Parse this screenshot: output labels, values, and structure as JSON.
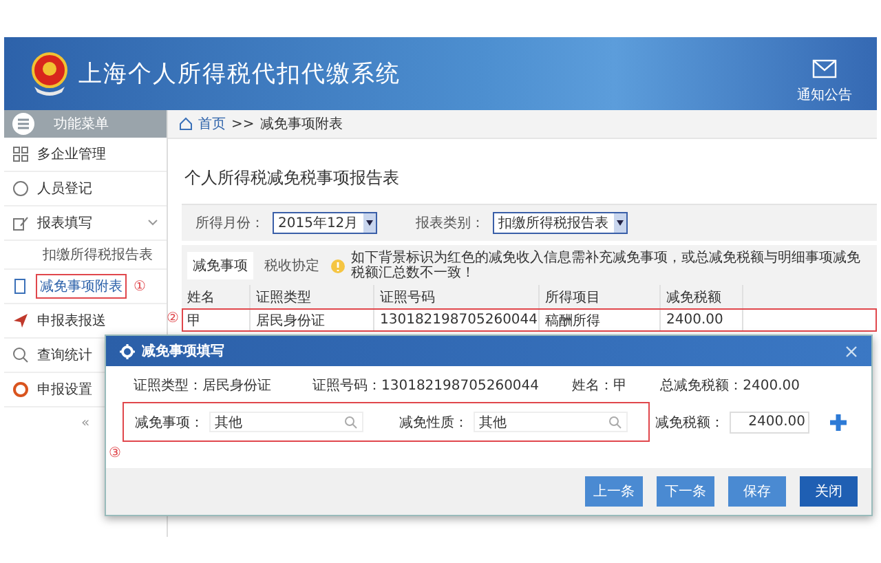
{
  "header": {
    "title": "上海个人所得税代扣代缴系统",
    "notice": "通知公告"
  },
  "sidebar": {
    "title": "功能菜单",
    "items": [
      {
        "label": "多企业管理",
        "selected": false
      },
      {
        "label": "人员登记",
        "selected": false
      },
      {
        "label": "报表填写",
        "selected": false,
        "expanded": true,
        "children": [
          {
            "label": "扣缴所得税报告表",
            "selected": false
          }
        ]
      },
      {
        "label": "减免事项附表",
        "selected": true,
        "marker": "①"
      },
      {
        "label": "申报表报送",
        "selected": false
      },
      {
        "label": "查询统计",
        "selected": false
      },
      {
        "label": "申报设置",
        "selected": false
      }
    ],
    "collapse": "«"
  },
  "breadcrumb": [
    "首页",
    ">>",
    "减免事项附表"
  ],
  "page_title": "个人所得税减免税事项报告表",
  "filters": [
    {
      "label": "所得月份：",
      "value": "2015年12月"
    },
    {
      "label": "报表类别：",
      "value": "扣缴所得税报告表"
    }
  ],
  "tabs": [
    {
      "label": "减免事项",
      "selected": true
    },
    {
      "label": "税收协定",
      "selected": false
    }
  ],
  "warning": "如下背景标识为红色的减免收入信息需补充减免事项，或总减免税额与明细事项减免税额汇总数不一致！",
  "table": {
    "columns": [
      "姓名",
      "证照类型",
      "证照号码",
      "所得项目",
      "减免税额"
    ],
    "rows": [
      {
        "cells": [
          "甲",
          "居民身份证",
          "130182198705260044",
          "稿酬所得",
          "2400.00"
        ],
        "marker": "②",
        "highlighted": true
      }
    ]
  },
  "dialog": {
    "title": "减免事项填写",
    "info": [
      {
        "label": "证照类型：",
        "value": "居民身份证"
      },
      {
        "label": "证照号码：",
        "value": "130182198705260044"
      },
      {
        "label": "姓名：",
        "value": "甲"
      },
      {
        "label": "总减免税额：",
        "value": "2400.00"
      }
    ],
    "fields": [
      {
        "label": "减免事项：",
        "value": "其他"
      },
      {
        "label": "减免性质：",
        "value": "其他"
      }
    ],
    "amount": {
      "label": "减免税额：",
      "value": "2400.00"
    },
    "marker": "③",
    "buttons": [
      {
        "label": "上一条",
        "primary": false
      },
      {
        "label": "下一条",
        "primary": false
      },
      {
        "label": "保存",
        "primary": false
      },
      {
        "label": "关闭",
        "primary": true
      }
    ]
  }
}
